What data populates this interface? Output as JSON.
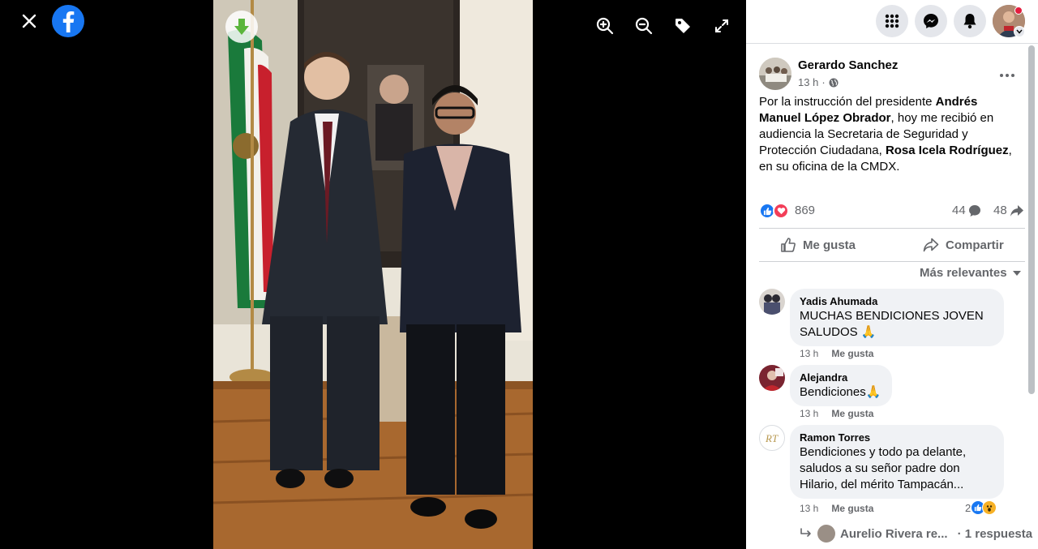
{
  "viewer": {
    "brand": "facebook",
    "icons": [
      "close-icon",
      "facebook-logo-icon",
      "zoom-in-icon",
      "zoom-out-icon",
      "tag-icon",
      "fullscreen-icon",
      "download-icon"
    ]
  },
  "topbar": {
    "icons": [
      "menu-grid-icon",
      "messenger-icon",
      "notifications-icon",
      "profile-icon"
    ]
  },
  "post": {
    "author": "Gerardo Sanchez",
    "time": "13 h",
    "privacy_icon": "globe-icon",
    "text_parts": [
      {
        "text": "Por la instrucción del presidente ",
        "bold": false
      },
      {
        "text": "Andrés Manuel López Obrador",
        "bold": true
      },
      {
        "text": ", hoy me recibió en audiencia la Secretaria de Seguridad y Protección Ciudadana, ",
        "bold": false
      },
      {
        "text": "Rosa Icela Rodríguez",
        "bold": true
      },
      {
        "text": ", en su oficina de la CMDX.",
        "bold": false
      }
    ],
    "reactions_count": "869",
    "comments_count": "44",
    "shares_count": "48",
    "like_label": "Me gusta",
    "share_label": "Compartir",
    "sort_label": "Más relevantes"
  },
  "comments": [
    {
      "name": "Yadis Ahumada",
      "text": "MUCHAS BENDICIONES JOVEN SALUDOS 🙏",
      "time": "13 h",
      "like": "Me gusta"
    },
    {
      "name": "Alejandra",
      "text": "Bendiciones🙏",
      "time": "13 h",
      "like": "Me gusta"
    },
    {
      "name": "Ramon Torres",
      "text": "Bendiciones y todo pa delante, saludos a su señor padre don Hilario, del mérito Tampacán...",
      "time": "13 h",
      "like": "Me gusta",
      "reactions": "2"
    }
  ],
  "reply": {
    "name": "Aurelio Rivera re...",
    "count": "· 1 respuesta"
  },
  "colors": {
    "accent": "#1877f2",
    "love": "#f33e58",
    "secondary_text": "#65676b",
    "bubble": "#f0f2f5"
  }
}
